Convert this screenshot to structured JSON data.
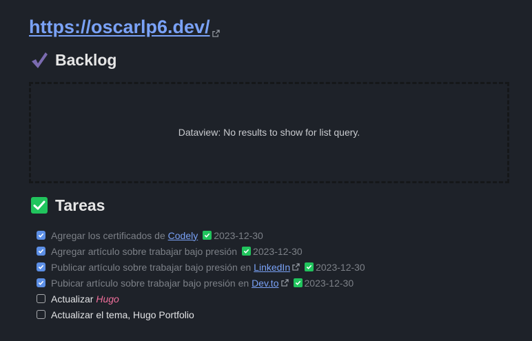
{
  "header": {
    "url": "https://oscarlp6.dev/"
  },
  "backlog": {
    "heading": "Backlog",
    "dataview_message": "Dataview: No results to show for list query."
  },
  "tareas": {
    "heading": "Tareas",
    "tasks": [
      {
        "prefix": "Agregar los certificados de ",
        "link": "Codely",
        "suffix": "",
        "date": "2023-12-30",
        "checked": true
      },
      {
        "prefix": "Agregar artículo sobre trabajar bajo presión",
        "link": "",
        "suffix": "",
        "date": "2023-12-30",
        "checked": true
      },
      {
        "prefix": "Publicar artículo sobre trabajar bajo presión en ",
        "link": "LinkedIn",
        "suffix": "",
        "date": "2023-12-30",
        "checked": true
      },
      {
        "prefix": "Pubicar artículo sobre trabajar bajo presión en ",
        "link": "Dev.to",
        "suffix": "",
        "date": "2023-12-30",
        "checked": true
      },
      {
        "prefix": "Actualizar ",
        "italic": "Hugo",
        "checked": false
      },
      {
        "prefix": "Actualizar el tema, Hugo Portfolio",
        "checked": false
      }
    ]
  },
  "colors": {
    "background": "#1e2229",
    "link": "#7aa2f7",
    "checkbox_checked": "#5c8fe6",
    "date_check": "#21c45d",
    "italic_accent": "#ef6f9b"
  },
  "icons": {
    "backlog_heading": "check-mark-icon",
    "tareas_heading": "check-box-icon",
    "external": "external-link-icon",
    "date": "done-date-icon"
  }
}
